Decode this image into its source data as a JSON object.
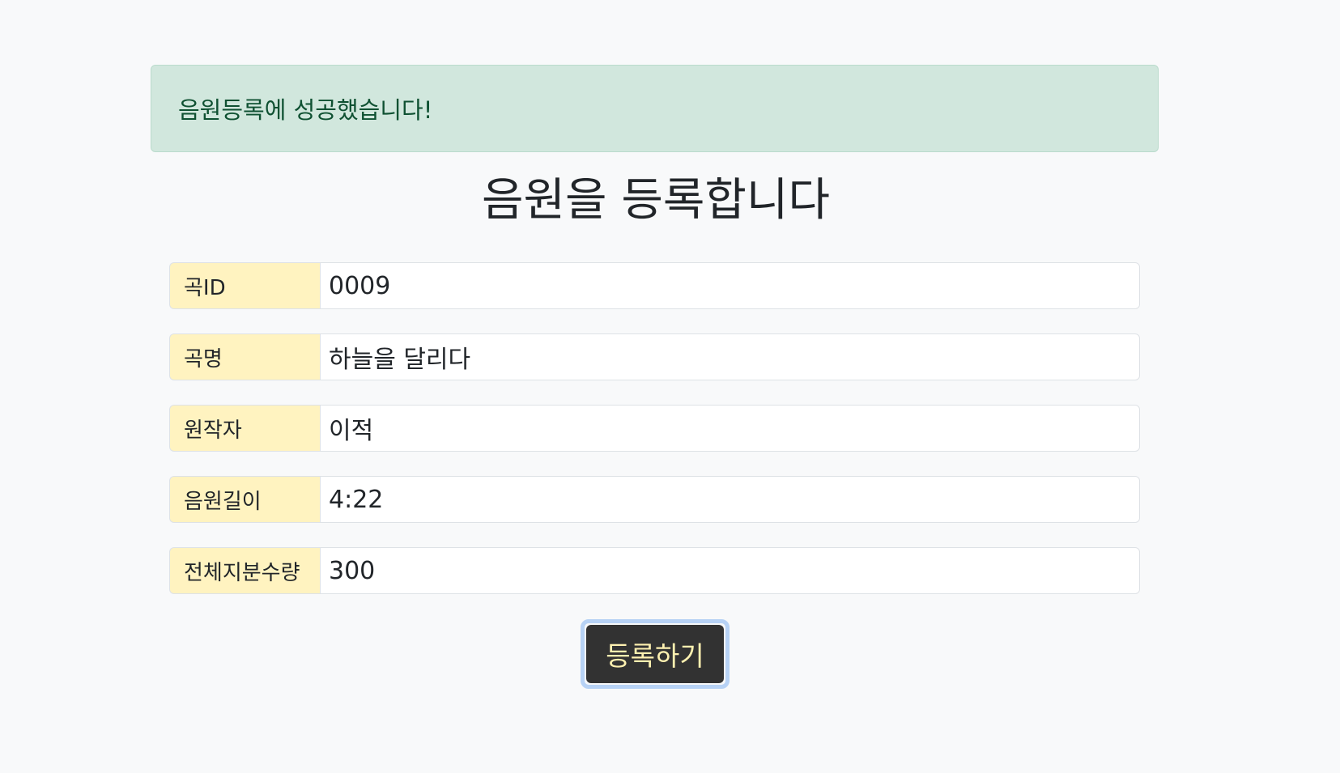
{
  "alert": {
    "message": "음원등록에 성공했습니다!"
  },
  "page_title": "음원을 등록합니다",
  "form": {
    "fields": [
      {
        "label": "곡ID",
        "value": "0009"
      },
      {
        "label": "곡명",
        "value": "하늘을 달리다"
      },
      {
        "label": "원작자",
        "value": "이적"
      },
      {
        "label": "음원길이",
        "value": "4:22"
      },
      {
        "label": "전체지분수량",
        "value": "300"
      }
    ],
    "submit_label": "등록하기"
  },
  "colors": {
    "alert_bg": "#d1e7dd",
    "alert_text": "#0f5132",
    "label_bg": "#fff3c0",
    "button_bg": "#323232",
    "button_text": "#fdf0b0",
    "button_focus_ring": "#b7d2f5"
  }
}
